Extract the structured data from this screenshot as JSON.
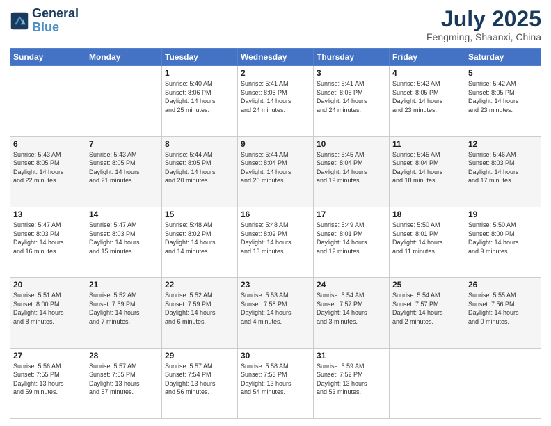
{
  "header": {
    "logo_line1": "General",
    "logo_line2": "Blue",
    "month_year": "July 2025",
    "location": "Fengming, Shaanxi, China"
  },
  "weekdays": [
    "Sunday",
    "Monday",
    "Tuesday",
    "Wednesday",
    "Thursday",
    "Friday",
    "Saturday"
  ],
  "rows": [
    [
      {
        "day": "",
        "detail": ""
      },
      {
        "day": "",
        "detail": ""
      },
      {
        "day": "1",
        "detail": "Sunrise: 5:40 AM\nSunset: 8:06 PM\nDaylight: 14 hours\nand 25 minutes."
      },
      {
        "day": "2",
        "detail": "Sunrise: 5:41 AM\nSunset: 8:05 PM\nDaylight: 14 hours\nand 24 minutes."
      },
      {
        "day": "3",
        "detail": "Sunrise: 5:41 AM\nSunset: 8:05 PM\nDaylight: 14 hours\nand 24 minutes."
      },
      {
        "day": "4",
        "detail": "Sunrise: 5:42 AM\nSunset: 8:05 PM\nDaylight: 14 hours\nand 23 minutes."
      },
      {
        "day": "5",
        "detail": "Sunrise: 5:42 AM\nSunset: 8:05 PM\nDaylight: 14 hours\nand 23 minutes."
      }
    ],
    [
      {
        "day": "6",
        "detail": "Sunrise: 5:43 AM\nSunset: 8:05 PM\nDaylight: 14 hours\nand 22 minutes."
      },
      {
        "day": "7",
        "detail": "Sunrise: 5:43 AM\nSunset: 8:05 PM\nDaylight: 14 hours\nand 21 minutes."
      },
      {
        "day": "8",
        "detail": "Sunrise: 5:44 AM\nSunset: 8:05 PM\nDaylight: 14 hours\nand 20 minutes."
      },
      {
        "day": "9",
        "detail": "Sunrise: 5:44 AM\nSunset: 8:04 PM\nDaylight: 14 hours\nand 20 minutes."
      },
      {
        "day": "10",
        "detail": "Sunrise: 5:45 AM\nSunset: 8:04 PM\nDaylight: 14 hours\nand 19 minutes."
      },
      {
        "day": "11",
        "detail": "Sunrise: 5:45 AM\nSunset: 8:04 PM\nDaylight: 14 hours\nand 18 minutes."
      },
      {
        "day": "12",
        "detail": "Sunrise: 5:46 AM\nSunset: 8:03 PM\nDaylight: 14 hours\nand 17 minutes."
      }
    ],
    [
      {
        "day": "13",
        "detail": "Sunrise: 5:47 AM\nSunset: 8:03 PM\nDaylight: 14 hours\nand 16 minutes."
      },
      {
        "day": "14",
        "detail": "Sunrise: 5:47 AM\nSunset: 8:03 PM\nDaylight: 14 hours\nand 15 minutes."
      },
      {
        "day": "15",
        "detail": "Sunrise: 5:48 AM\nSunset: 8:02 PM\nDaylight: 14 hours\nand 14 minutes."
      },
      {
        "day": "16",
        "detail": "Sunrise: 5:48 AM\nSunset: 8:02 PM\nDaylight: 14 hours\nand 13 minutes."
      },
      {
        "day": "17",
        "detail": "Sunrise: 5:49 AM\nSunset: 8:01 PM\nDaylight: 14 hours\nand 12 minutes."
      },
      {
        "day": "18",
        "detail": "Sunrise: 5:50 AM\nSunset: 8:01 PM\nDaylight: 14 hours\nand 11 minutes."
      },
      {
        "day": "19",
        "detail": "Sunrise: 5:50 AM\nSunset: 8:00 PM\nDaylight: 14 hours\nand 9 minutes."
      }
    ],
    [
      {
        "day": "20",
        "detail": "Sunrise: 5:51 AM\nSunset: 8:00 PM\nDaylight: 14 hours\nand 8 minutes."
      },
      {
        "day": "21",
        "detail": "Sunrise: 5:52 AM\nSunset: 7:59 PM\nDaylight: 14 hours\nand 7 minutes."
      },
      {
        "day": "22",
        "detail": "Sunrise: 5:52 AM\nSunset: 7:59 PM\nDaylight: 14 hours\nand 6 minutes."
      },
      {
        "day": "23",
        "detail": "Sunrise: 5:53 AM\nSunset: 7:58 PM\nDaylight: 14 hours\nand 4 minutes."
      },
      {
        "day": "24",
        "detail": "Sunrise: 5:54 AM\nSunset: 7:57 PM\nDaylight: 14 hours\nand 3 minutes."
      },
      {
        "day": "25",
        "detail": "Sunrise: 5:54 AM\nSunset: 7:57 PM\nDaylight: 14 hours\nand 2 minutes."
      },
      {
        "day": "26",
        "detail": "Sunrise: 5:55 AM\nSunset: 7:56 PM\nDaylight: 14 hours\nand 0 minutes."
      }
    ],
    [
      {
        "day": "27",
        "detail": "Sunrise: 5:56 AM\nSunset: 7:55 PM\nDaylight: 13 hours\nand 59 minutes."
      },
      {
        "day": "28",
        "detail": "Sunrise: 5:57 AM\nSunset: 7:55 PM\nDaylight: 13 hours\nand 57 minutes."
      },
      {
        "day": "29",
        "detail": "Sunrise: 5:57 AM\nSunset: 7:54 PM\nDaylight: 13 hours\nand 56 minutes."
      },
      {
        "day": "30",
        "detail": "Sunrise: 5:58 AM\nSunset: 7:53 PM\nDaylight: 13 hours\nand 54 minutes."
      },
      {
        "day": "31",
        "detail": "Sunrise: 5:59 AM\nSunset: 7:52 PM\nDaylight: 13 hours\nand 53 minutes."
      },
      {
        "day": "",
        "detail": ""
      },
      {
        "day": "",
        "detail": ""
      }
    ]
  ]
}
